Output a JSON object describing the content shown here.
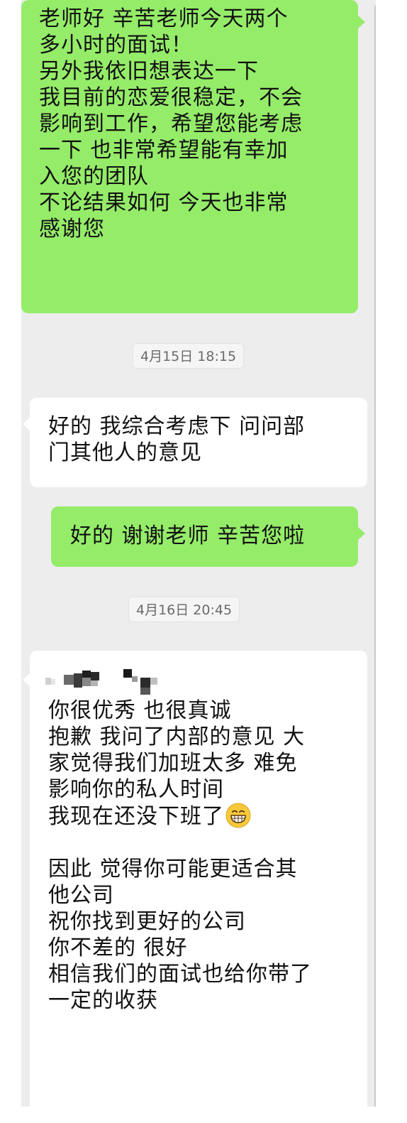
{
  "messages": [
    {
      "id": "msg1",
      "sender": "me",
      "lines": [
        "老师好 辛苦老师今天两个",
        "多小时的面试！",
        "另外我依旧想表达一下",
        "我目前的恋爱很稳定，不会",
        "影响到工作，希望您能考虑",
        "一下 也非常希望能有幸加",
        "入您的团队",
        "不论结果如何 今天也非常",
        "感谢您"
      ]
    },
    {
      "id": "ts1",
      "timestamp": "4月15日 18:15"
    },
    {
      "id": "msg2",
      "sender": "interviewer",
      "lines": [
        "好的 我综合考虑下 问问部",
        "门其他人的意见"
      ]
    },
    {
      "id": "msg3",
      "sender": "me",
      "lines": [
        "好的 谢谢老师 辛苦您啦"
      ]
    },
    {
      "id": "ts2",
      "timestamp": "4月16日 20:45"
    },
    {
      "id": "msg4",
      "sender": "interviewer",
      "lines": [
        "你很优秀 也很真诚",
        "抱歉 我问了内部的意见 大",
        "家觉得我们加班太多 难免",
        "影响你的私人时间",
        "我现在还没下班了",
        "",
        "因此 觉得你可能更适合其",
        "他公司",
        "祝你找到更好的公司",
        "你不差的 很好",
        "相信我们的面试也给你带了",
        "一定的收获"
      ],
      "emoji_after_line": 4,
      "emoji": "grinning-face-emoji"
    }
  ],
  "colors": {
    "chat_background": "#ededed",
    "sent_bubble": "#95ec69",
    "received_bubble": "#ffffff",
    "text": "#111111",
    "timestamp_text": "#6b6b6b"
  }
}
